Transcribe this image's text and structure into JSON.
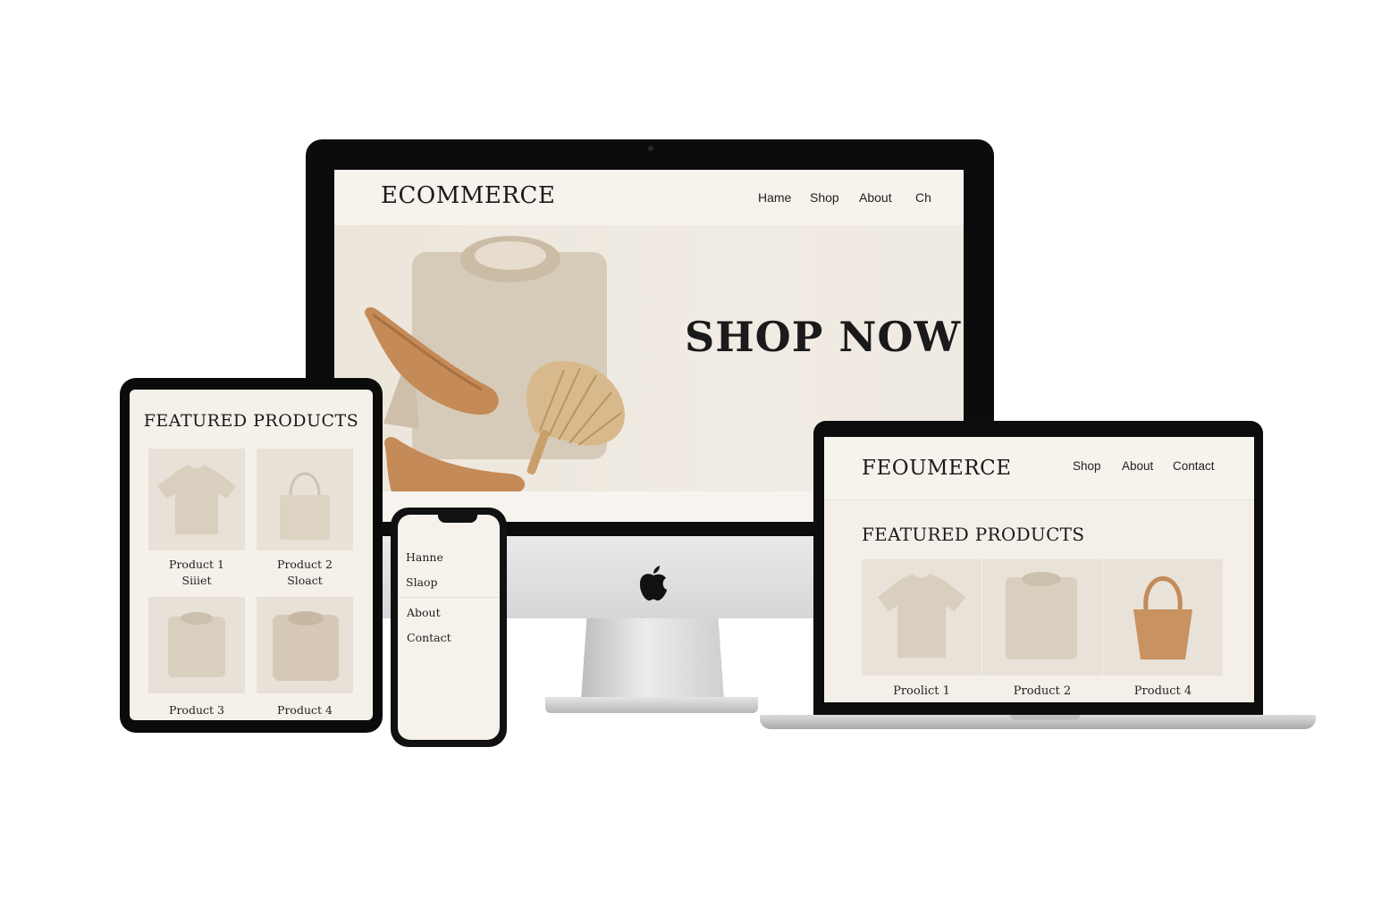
{
  "imac": {
    "logo": "ECOMMERCE",
    "nav": [
      "Hame",
      "Shop",
      "About",
      "Ch"
    ],
    "hero_cta": "SHOP NOW"
  },
  "tablet": {
    "title": "FEATURED PRODUCTS",
    "products": [
      {
        "name": "Product 1",
        "sub": "Siiiet",
        "image": "tshirt-icon"
      },
      {
        "name": "Product 2",
        "sub": "Sloact",
        "image": "tote-bag-icon"
      },
      {
        "name": "Product 3",
        "sub": "",
        "image": "folded-shirt-icon"
      },
      {
        "name": "Product 4",
        "sub": "",
        "image": "folded-sweater-icon"
      }
    ]
  },
  "phone": {
    "menu": [
      "Hanne",
      "Slaop",
      "About",
      "Contact"
    ]
  },
  "laptop": {
    "logo": "FEOUMERCE",
    "nav": [
      "Shop",
      "About",
      "Contact"
    ],
    "title": "FEATURED PRODUCTS",
    "products": [
      {
        "name": "Proolict 1",
        "image": "tshirt-icon"
      },
      {
        "name": "Product 2",
        "image": "folded-shirt-icon"
      },
      {
        "name": "Product 4",
        "image": "handbag-icon"
      }
    ]
  },
  "colors": {
    "page_bg": "#ffffff",
    "screen_bg": "#f4f0e9",
    "product_beige": "#d9cfbf",
    "leather_tan": "#c48a57",
    "text_dark": "#1a1a1a"
  }
}
